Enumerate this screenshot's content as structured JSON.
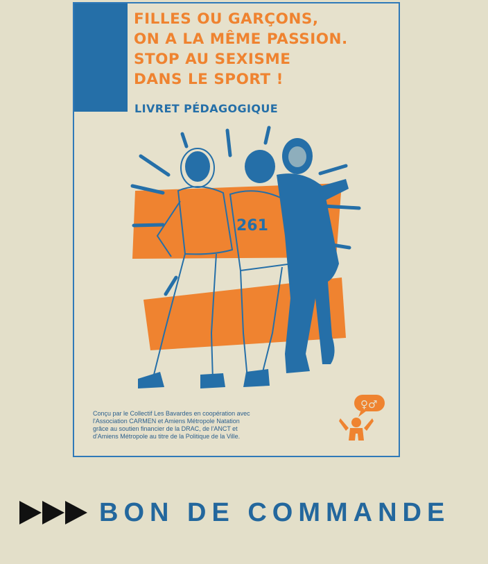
{
  "poster": {
    "headline_lines": [
      "FILLES OU GARÇONS,",
      "ON A LA MÊME PASSION.",
      "STOP AU SEXISME",
      "DANS LE SPORT !"
    ],
    "subtitle": "LIVRET PÉDAGOGIQUE",
    "credit_lines": [
      "Conçu par le Collectif Les Bavardes en coopération avec",
      "l'Association CARMEN et Amiens Métropole Natation",
      "grâce au soutien financier de la DRAC, de l'ANCT et",
      "d'Amiens Métropole au titre de la Politique de la Ville."
    ],
    "bib_number": "261",
    "logo_symbols": "♀♂",
    "colors": {
      "orange": "#ef8330",
      "blue": "#256fa8",
      "cream": "#e6e1cc",
      "border": "#2f79b8"
    }
  },
  "order": {
    "label": "BON DE COMMANDE",
    "icon": "triple-play-arrows-icon"
  }
}
